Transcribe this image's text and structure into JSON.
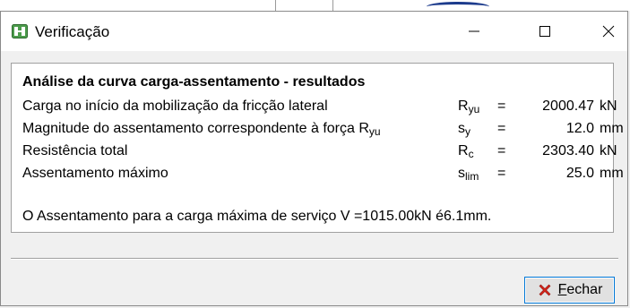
{
  "window": {
    "title": "Verificação",
    "controls": {
      "minimize": "—",
      "maximize": "☐",
      "close": "✕"
    }
  },
  "results": {
    "heading": "Análise da curva carga-assentamento - resultados",
    "rows": [
      {
        "label": "Carga no início da mobilização da fricção lateral",
        "symbol": "R",
        "symbol_sub": "yu",
        "eq": "=",
        "value": "2000.47",
        "unit": "kN"
      },
      {
        "label": "Magnitude do assentamento correspondente à força R",
        "label_sub": "yu",
        "symbol": "s",
        "symbol_sub": "y",
        "eq": "=",
        "value": "12.0",
        "unit": "mm"
      },
      {
        "label": "Resistência total",
        "symbol": "R",
        "symbol_sub": "c",
        "eq": "=",
        "value": "2303.40",
        "unit": "kN"
      },
      {
        "label": "Assentamento máximo",
        "symbol": "s",
        "symbol_sub": "lim",
        "eq": "=",
        "value": "25.0",
        "unit": "mm"
      }
    ],
    "note": "O Assentamento para a carga máxima de serviço V =1015.00kN é6.1mm."
  },
  "footer": {
    "close_button": {
      "mnemonic": "F",
      "rest": "echar",
      "icon": "red-x-icon"
    }
  },
  "colors": {
    "accent": "#0078d7",
    "close_icon": "#d9261c",
    "app_icon": "#3c8c3c"
  }
}
